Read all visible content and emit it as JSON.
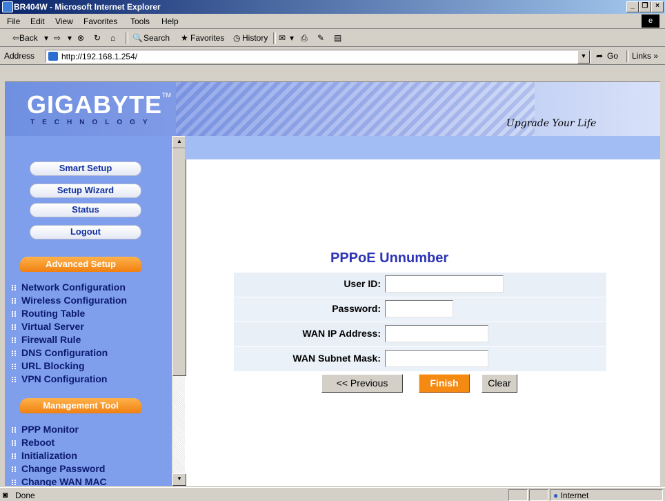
{
  "window": {
    "title": "BR404W - Microsoft Internet Explorer",
    "min": "_",
    "max": "❐",
    "close": "×"
  },
  "menu": [
    "File",
    "Edit",
    "View",
    "Favorites",
    "Tools",
    "Help"
  ],
  "toolbar": {
    "back": "⇦Back",
    "forward": "⇨",
    "stop": "⊗",
    "refresh": "↻",
    "home": "⌂",
    "search": "Search",
    "favorites": "Favorites",
    "history": "History"
  },
  "address": {
    "label": "Address",
    "url": "http://192.168.1.254/",
    "go": "Go",
    "links": "Links »"
  },
  "banner": {
    "logo": "GIGABYTE",
    "tm": "TM",
    "logo_sub": "TECHNOLOGY",
    "slogan": "Upgrade Your Life"
  },
  "sidebar": {
    "buttons": [
      "Smart Setup",
      "Setup Wizard",
      "Status",
      "Logout"
    ],
    "sections": [
      {
        "title": "Advanced Setup",
        "links": [
          "Network Configuration",
          "Wireless Configuration",
          "Routing Table",
          "Virtual Server",
          "Firewall Rule",
          "DNS Configuration",
          "URL Blocking",
          "VPN Configuration"
        ]
      },
      {
        "title": "Management Tool",
        "links": [
          "PPP Monitor",
          "Reboot",
          "Initialization",
          "Change Password",
          "Change WAN MAC"
        ]
      }
    ]
  },
  "form": {
    "title": "PPPoE Unnumber",
    "fields": [
      {
        "label": "User ID:",
        "value": ""
      },
      {
        "label": "Password:",
        "value": ""
      },
      {
        "label": "WAN IP Address:",
        "value": ""
      },
      {
        "label": "WAN Subnet Mask:",
        "value": ""
      }
    ],
    "buttons": {
      "previous": "<< Previous",
      "finish": "Finish",
      "clear": "Clear"
    }
  },
  "status": {
    "text": "Done",
    "zone": "Internet"
  }
}
